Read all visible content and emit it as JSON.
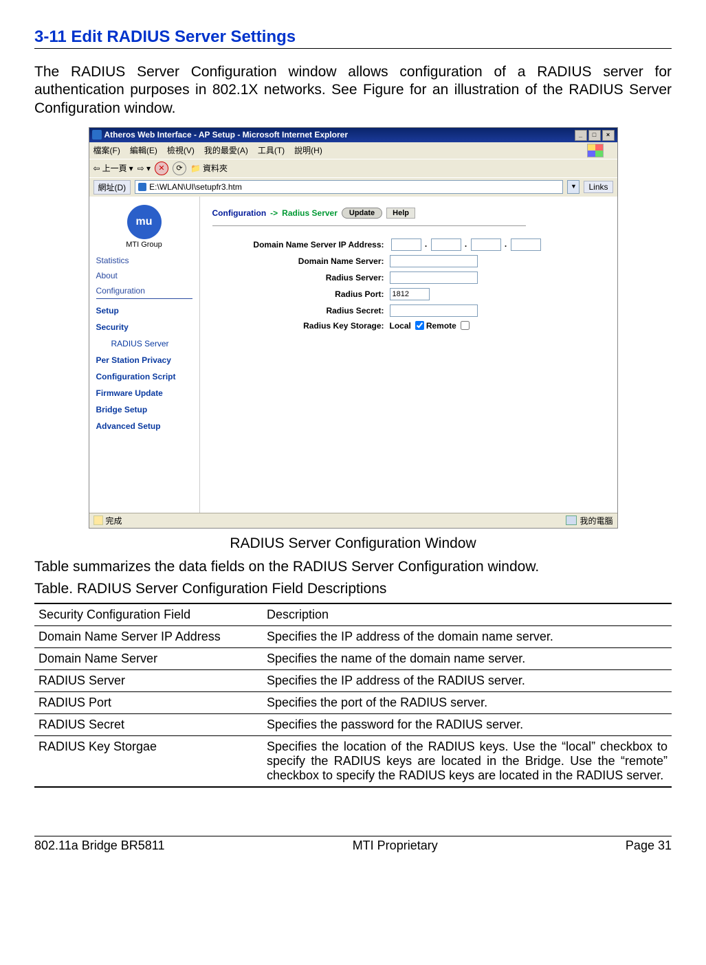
{
  "section_title": "3-11 Edit RADIUS Server Settings",
  "intro": "The RADIUS Server Configuration window allows configuration of a RADIUS server for authentication purposes in 802.1X networks. See Figure for an illustration of the RADIUS Server Configuration window.",
  "caption": "RADIUS Server Configuration Window",
  "summary_line": "Table summarizes the data fields on the RADIUS Server Configuration window.",
  "table_title": "Table. RADIUS Server Configuration Field Descriptions",
  "table": {
    "header": {
      "c1": "Security Configuration Field",
      "c2": "Description"
    },
    "rows": [
      {
        "c1": "Domain Name Server IP Address",
        "c2": "Specifies the IP address of the domain name server."
      },
      {
        "c1": "Domain Name Server",
        "c2": "Specifies the name of the domain name server."
      },
      {
        "c1": "RADIUS Server",
        "c2": "Specifies the IP address of the RADIUS server."
      },
      {
        "c1": "RADIUS Port",
        "c2": "Specifies the port of the RADIUS server."
      },
      {
        "c1": "RADIUS Secret",
        "c2": "Specifies the password for the RADIUS server."
      },
      {
        "c1": "RADIUS Key Storgae",
        "c2": "Specifies the location of the RADIUS keys. Use the “local” checkbox to specify the RADIUS keys are located in the Bridge. Use the “remote” checkbox to specify the RADIUS keys are located in the RADIUS server."
      }
    ]
  },
  "footer": {
    "left": "802.11a Bridge BR5811",
    "center": "MTI Proprietary",
    "right": "Page 31"
  },
  "screenshot": {
    "titlebar": "Atheros Web Interface - AP Setup - Microsoft Internet Explorer",
    "winbtns": {
      "min": "_",
      "max": "□",
      "close": "×"
    },
    "menu": [
      "檔案(F)",
      "編輯(E)",
      "檢視(V)",
      "我的最愛(A)",
      "工具(T)",
      "說明(H)"
    ],
    "toolbar": {
      "back": "上一頁",
      "folders": "資料夾"
    },
    "address": {
      "label": "網址(D)",
      "value": "E:\\WLAN\\UI\\setupfr3.htm",
      "links": "Links"
    },
    "sidebar": {
      "brand": "MTI Group",
      "logo_text": "mu",
      "top_links": [
        "Statistics",
        "About",
        "Configuration"
      ],
      "sub_links": [
        "Setup",
        "Security",
        "RADIUS Server",
        "Per Station Privacy",
        "Configuration Script",
        "Firmware Update",
        "Bridge Setup",
        "Advanced Setup"
      ]
    },
    "main": {
      "configuration": "Configuration",
      "arrow": "->",
      "radius_server": "Radius Server",
      "update": "Update",
      "help": "Help",
      "fields": {
        "dns_ip": "Domain Name Server IP Address:",
        "dns": "Domain Name Server:",
        "rserver": "Radius Server:",
        "rport": "Radius Port:",
        "rport_value": "1812",
        "rsecret": "Radius Secret:",
        "rkey": "Radius Key Storage:",
        "local": "Local",
        "remote": "Remote"
      }
    },
    "status": {
      "done": "完成",
      "zone": "我的電腦"
    }
  }
}
